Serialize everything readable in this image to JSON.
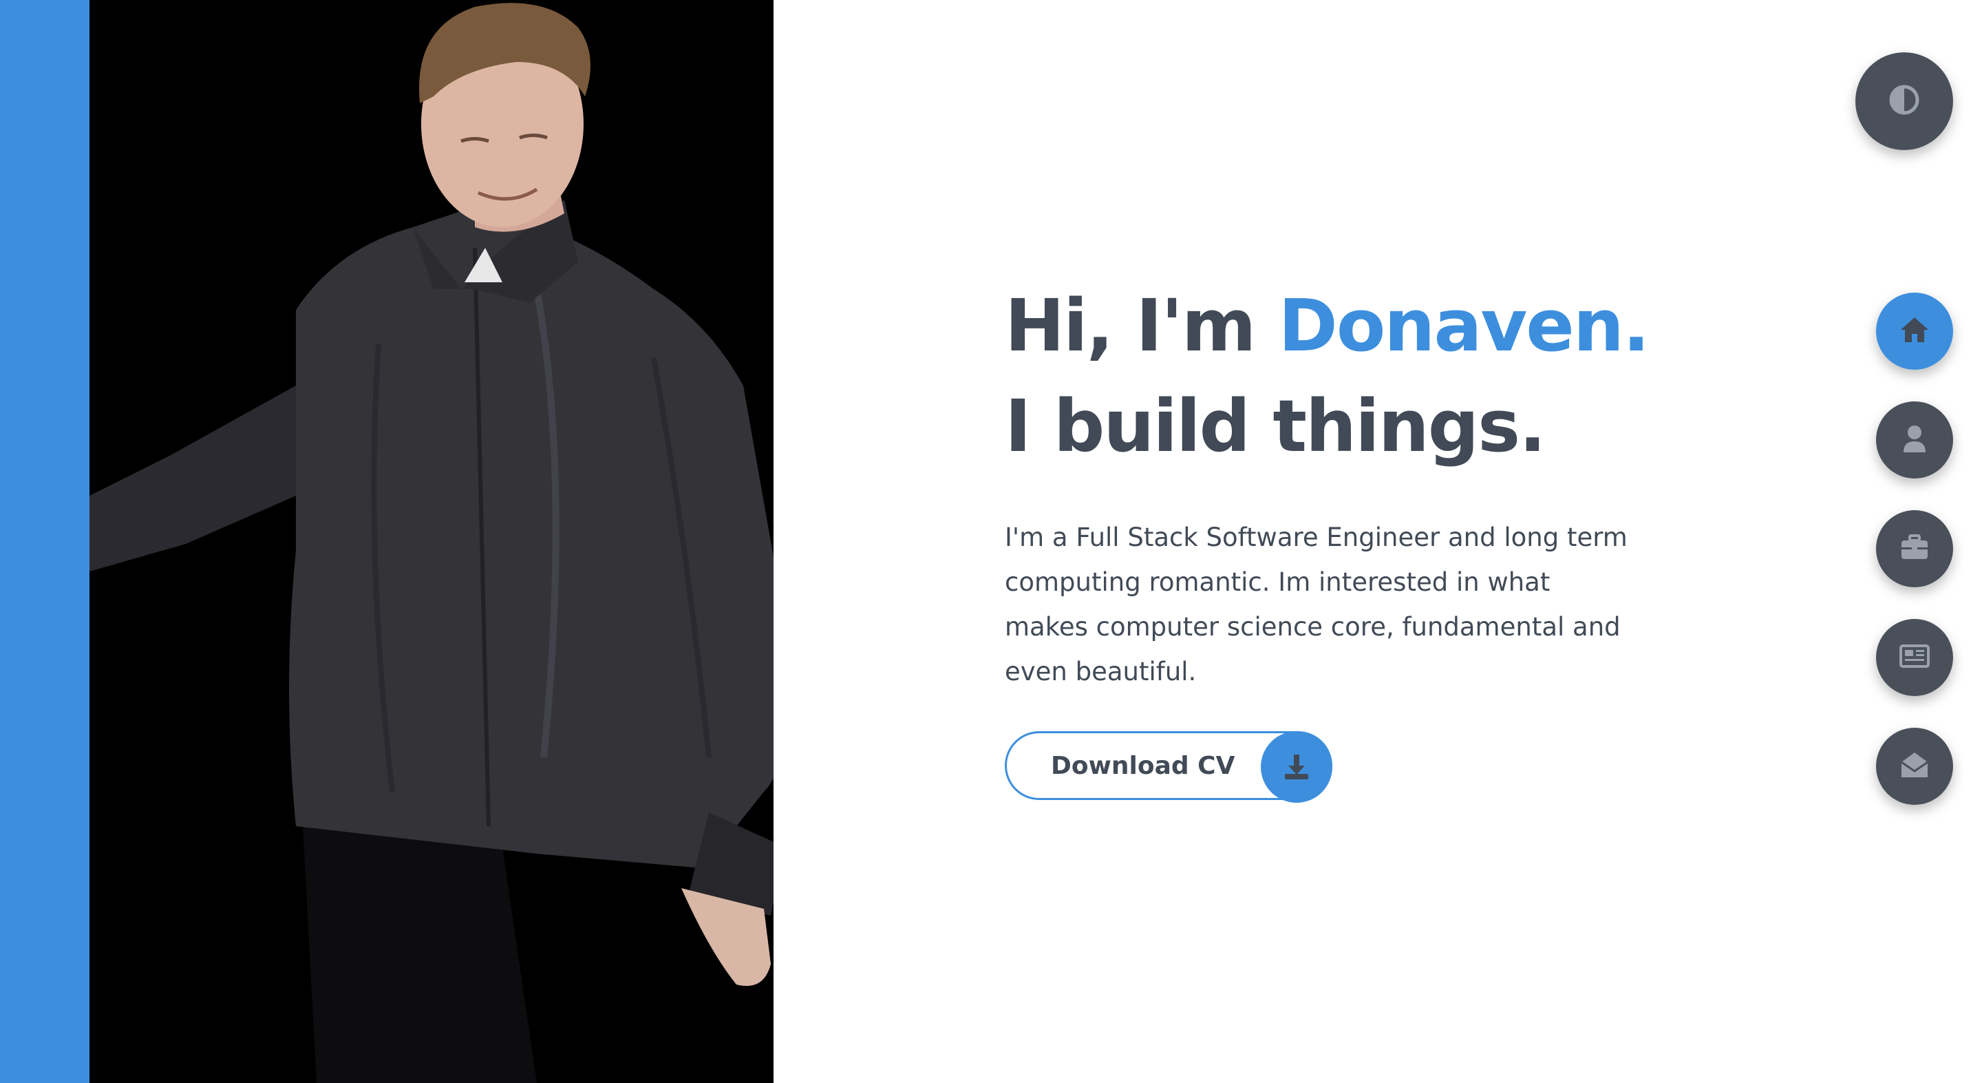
{
  "hero": {
    "greeting": "Hi, I'm ",
    "name": "Donaven.",
    "tagline": "I build things.",
    "description": "I'm a Full Stack Software Engineer and long term computing romantic. Im interested in what makes computer science core, fundamental and even beautiful."
  },
  "cv_button": {
    "label": "Download CV",
    "icon": "download-icon"
  },
  "theme_toggle": {
    "icon": "contrast-icon"
  },
  "nav": {
    "active": "home",
    "items": [
      {
        "id": "home",
        "icon": "home-icon"
      },
      {
        "id": "about",
        "icon": "user-icon"
      },
      {
        "id": "portfolio",
        "icon": "briefcase-icon"
      },
      {
        "id": "blog",
        "icon": "newspaper-icon"
      },
      {
        "id": "contact",
        "icon": "envelope-open-icon"
      }
    ]
  },
  "colors": {
    "accent": "#3d8fde",
    "text": "#414a56",
    "nav_button": "#4a505a",
    "icon_muted": "#9aa1ab",
    "photo_background": "#000000"
  }
}
